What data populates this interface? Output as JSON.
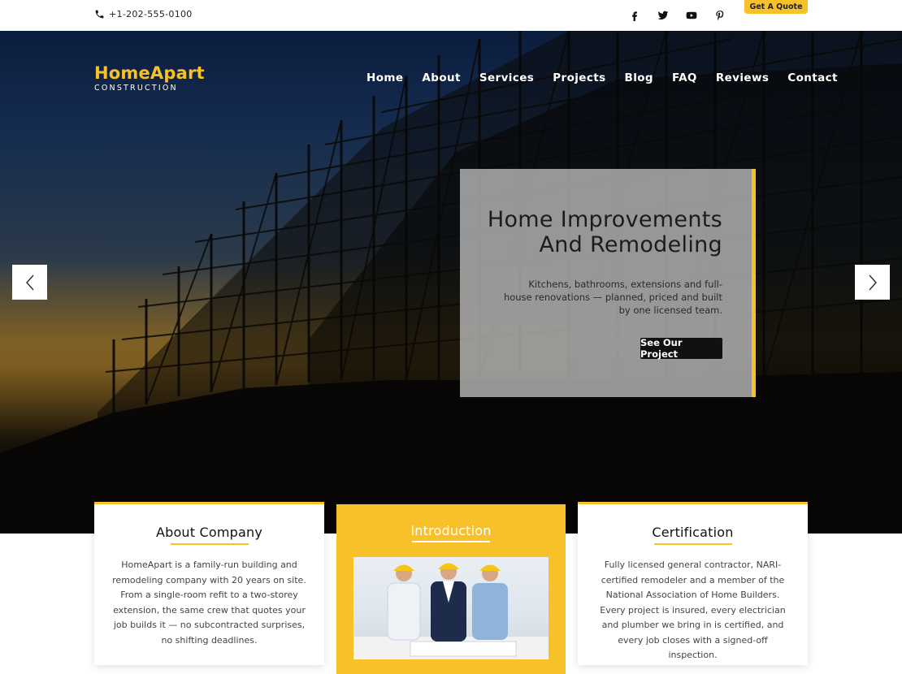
{
  "topbar": {
    "phone": "+1-202-555-0100",
    "phone_icon": "phone-icon",
    "socials": [
      "facebook-icon",
      "twitter-icon",
      "youtube-icon",
      "pinterest-icon"
    ],
    "quote_button": "Get A Quote"
  },
  "brand": {
    "name": "HomeApart",
    "tagline": "CONSTRUCTION"
  },
  "nav": {
    "items": [
      "Home",
      "About",
      "Services",
      "Projects",
      "Blog",
      "FAQ",
      "Reviews",
      "Contact"
    ]
  },
  "slider": {
    "title_line1": "Home Improvements",
    "title_line2": "And Remodeling",
    "text": "Kitchens, bathrooms, extensions and full-house renovations — planned, priced and built by one licensed team.",
    "button": "See Our Project",
    "prev_icon": "chevron-left-icon",
    "next_icon": "chevron-right-icon"
  },
  "cards": {
    "about": {
      "title": "About Company",
      "text": "HomeApart is a family-run building and remodeling company with 20 years on site. From a single-room refit to a two-storey extension, the same crew that quotes your job builds it — no subcontracted surprises, no shifting deadlines."
    },
    "intro": {
      "title": "Introduction"
    },
    "cert": {
      "title": "Certification",
      "text": "Fully licensed general contractor, NARI-certified remodeler and a member of the National Association of Home Builders. Every project is insured, every electrician and plumber we bring in is certified, and every job closes with a signed-off inspection."
    }
  },
  "colors": {
    "accent": "#f8c12a",
    "dark": "#111111"
  }
}
